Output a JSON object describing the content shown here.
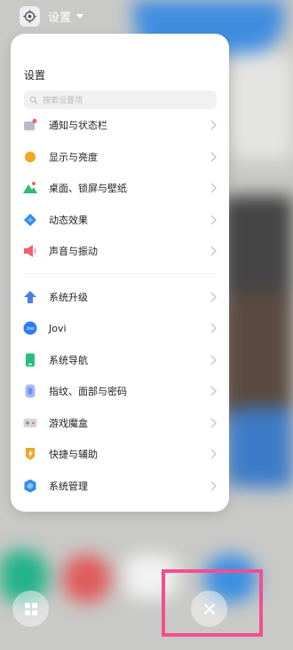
{
  "app_header": {
    "title": "设置"
  },
  "panel": {
    "title": "设置",
    "search_placeholder": "搜索设置项"
  },
  "menu": [
    {
      "label": "通知与状态栏",
      "icon": "notification-icon",
      "color": "#9aa3b0"
    },
    {
      "label": "显示与亮度",
      "icon": "brightness-icon",
      "color": "#f5a623"
    },
    {
      "label": "桌面、锁屏与壁纸",
      "icon": "wallpaper-icon",
      "color": "#2dbd6e"
    },
    {
      "label": "动态效果",
      "icon": "animation-icon",
      "color": "#2e8cf0"
    },
    {
      "label": "声音与振动",
      "icon": "sound-icon",
      "color": "#f0606b"
    },
    {
      "label": "系统升级",
      "icon": "upgrade-icon",
      "color": "#4a7fe8"
    },
    {
      "label": "Jovi",
      "icon": "jovi-icon",
      "color": "#2b7cf0"
    },
    {
      "label": "系统导航",
      "icon": "navigation-icon",
      "color": "#27c07b"
    },
    {
      "label": "指纹、面部与密码",
      "icon": "fingerprint-icon",
      "color": "#6f8cf0"
    },
    {
      "label": "游戏魔盒",
      "icon": "game-icon",
      "color": "#c9ccd2"
    },
    {
      "label": "快捷与辅助",
      "icon": "shortcut-icon",
      "color": "#f5a623"
    },
    {
      "label": "系统管理",
      "icon": "system-management-icon",
      "color": "#2e8cf0"
    }
  ],
  "icons": {
    "Jovi": "Jovi"
  },
  "accent": {
    "highlight_border": "#f24e90"
  }
}
